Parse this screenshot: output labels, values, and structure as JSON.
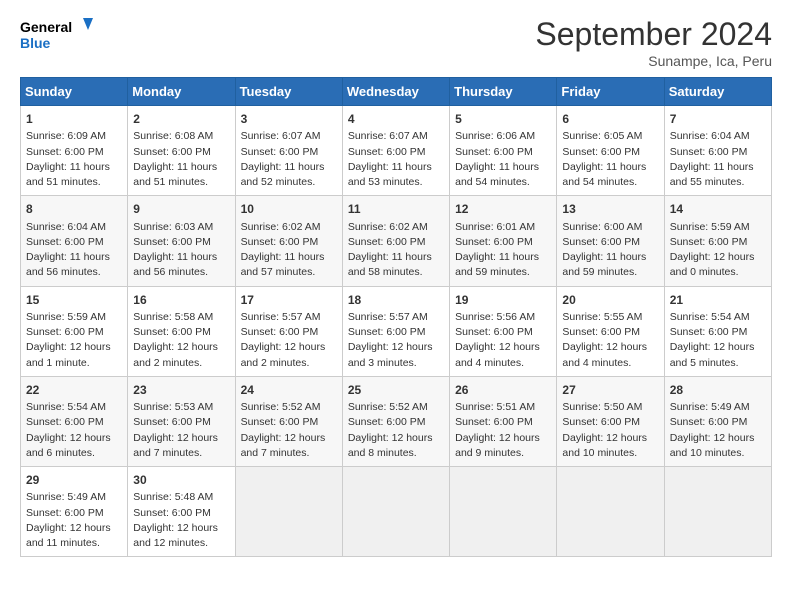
{
  "header": {
    "logo_line1": "General",
    "logo_line2": "Blue",
    "month_title": "September 2024",
    "location": "Sunampe, Ica, Peru"
  },
  "days_of_week": [
    "Sunday",
    "Monday",
    "Tuesday",
    "Wednesday",
    "Thursday",
    "Friday",
    "Saturday"
  ],
  "weeks": [
    [
      {
        "day": "1",
        "lines": [
          "Sunrise: 6:09 AM",
          "Sunset: 6:00 PM",
          "Daylight: 11 hours",
          "and 51 minutes."
        ]
      },
      {
        "day": "2",
        "lines": [
          "Sunrise: 6:08 AM",
          "Sunset: 6:00 PM",
          "Daylight: 11 hours",
          "and 51 minutes."
        ]
      },
      {
        "day": "3",
        "lines": [
          "Sunrise: 6:07 AM",
          "Sunset: 6:00 PM",
          "Daylight: 11 hours",
          "and 52 minutes."
        ]
      },
      {
        "day": "4",
        "lines": [
          "Sunrise: 6:07 AM",
          "Sunset: 6:00 PM",
          "Daylight: 11 hours",
          "and 53 minutes."
        ]
      },
      {
        "day": "5",
        "lines": [
          "Sunrise: 6:06 AM",
          "Sunset: 6:00 PM",
          "Daylight: 11 hours",
          "and 54 minutes."
        ]
      },
      {
        "day": "6",
        "lines": [
          "Sunrise: 6:05 AM",
          "Sunset: 6:00 PM",
          "Daylight: 11 hours",
          "and 54 minutes."
        ]
      },
      {
        "day": "7",
        "lines": [
          "Sunrise: 6:04 AM",
          "Sunset: 6:00 PM",
          "Daylight: 11 hours",
          "and 55 minutes."
        ]
      }
    ],
    [
      {
        "day": "8",
        "lines": [
          "Sunrise: 6:04 AM",
          "Sunset: 6:00 PM",
          "Daylight: 11 hours",
          "and 56 minutes."
        ]
      },
      {
        "day": "9",
        "lines": [
          "Sunrise: 6:03 AM",
          "Sunset: 6:00 PM",
          "Daylight: 11 hours",
          "and 56 minutes."
        ]
      },
      {
        "day": "10",
        "lines": [
          "Sunrise: 6:02 AM",
          "Sunset: 6:00 PM",
          "Daylight: 11 hours",
          "and 57 minutes."
        ]
      },
      {
        "day": "11",
        "lines": [
          "Sunrise: 6:02 AM",
          "Sunset: 6:00 PM",
          "Daylight: 11 hours",
          "and 58 minutes."
        ]
      },
      {
        "day": "12",
        "lines": [
          "Sunrise: 6:01 AM",
          "Sunset: 6:00 PM",
          "Daylight: 11 hours",
          "and 59 minutes."
        ]
      },
      {
        "day": "13",
        "lines": [
          "Sunrise: 6:00 AM",
          "Sunset: 6:00 PM",
          "Daylight: 11 hours",
          "and 59 minutes."
        ]
      },
      {
        "day": "14",
        "lines": [
          "Sunrise: 5:59 AM",
          "Sunset: 6:00 PM",
          "Daylight: 12 hours",
          "and 0 minutes."
        ]
      }
    ],
    [
      {
        "day": "15",
        "lines": [
          "Sunrise: 5:59 AM",
          "Sunset: 6:00 PM",
          "Daylight: 12 hours",
          "and 1 minute."
        ]
      },
      {
        "day": "16",
        "lines": [
          "Sunrise: 5:58 AM",
          "Sunset: 6:00 PM",
          "Daylight: 12 hours",
          "and 2 minutes."
        ]
      },
      {
        "day": "17",
        "lines": [
          "Sunrise: 5:57 AM",
          "Sunset: 6:00 PM",
          "Daylight: 12 hours",
          "and 2 minutes."
        ]
      },
      {
        "day": "18",
        "lines": [
          "Sunrise: 5:57 AM",
          "Sunset: 6:00 PM",
          "Daylight: 12 hours",
          "and 3 minutes."
        ]
      },
      {
        "day": "19",
        "lines": [
          "Sunrise: 5:56 AM",
          "Sunset: 6:00 PM",
          "Daylight: 12 hours",
          "and 4 minutes."
        ]
      },
      {
        "day": "20",
        "lines": [
          "Sunrise: 5:55 AM",
          "Sunset: 6:00 PM",
          "Daylight: 12 hours",
          "and 4 minutes."
        ]
      },
      {
        "day": "21",
        "lines": [
          "Sunrise: 5:54 AM",
          "Sunset: 6:00 PM",
          "Daylight: 12 hours",
          "and 5 minutes."
        ]
      }
    ],
    [
      {
        "day": "22",
        "lines": [
          "Sunrise: 5:54 AM",
          "Sunset: 6:00 PM",
          "Daylight: 12 hours",
          "and 6 minutes."
        ]
      },
      {
        "day": "23",
        "lines": [
          "Sunrise: 5:53 AM",
          "Sunset: 6:00 PM",
          "Daylight: 12 hours",
          "and 7 minutes."
        ]
      },
      {
        "day": "24",
        "lines": [
          "Sunrise: 5:52 AM",
          "Sunset: 6:00 PM",
          "Daylight: 12 hours",
          "and 7 minutes."
        ]
      },
      {
        "day": "25",
        "lines": [
          "Sunrise: 5:52 AM",
          "Sunset: 6:00 PM",
          "Daylight: 12 hours",
          "and 8 minutes."
        ]
      },
      {
        "day": "26",
        "lines": [
          "Sunrise: 5:51 AM",
          "Sunset: 6:00 PM",
          "Daylight: 12 hours",
          "and 9 minutes."
        ]
      },
      {
        "day": "27",
        "lines": [
          "Sunrise: 5:50 AM",
          "Sunset: 6:00 PM",
          "Daylight: 12 hours",
          "and 10 minutes."
        ]
      },
      {
        "day": "28",
        "lines": [
          "Sunrise: 5:49 AM",
          "Sunset: 6:00 PM",
          "Daylight: 12 hours",
          "and 10 minutes."
        ]
      }
    ],
    [
      {
        "day": "29",
        "lines": [
          "Sunrise: 5:49 AM",
          "Sunset: 6:00 PM",
          "Daylight: 12 hours",
          "and 11 minutes."
        ]
      },
      {
        "day": "30",
        "lines": [
          "Sunrise: 5:48 AM",
          "Sunset: 6:00 PM",
          "Daylight: 12 hours",
          "and 12 minutes."
        ]
      },
      {
        "day": "",
        "lines": [],
        "empty": true
      },
      {
        "day": "",
        "lines": [],
        "empty": true
      },
      {
        "day": "",
        "lines": [],
        "empty": true
      },
      {
        "day": "",
        "lines": [],
        "empty": true
      },
      {
        "day": "",
        "lines": [],
        "empty": true
      }
    ]
  ]
}
